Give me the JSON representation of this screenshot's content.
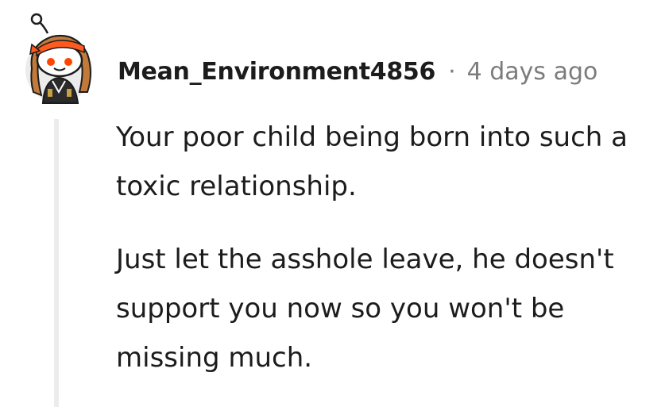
{
  "comment": {
    "author": "Mean_Environment4856",
    "separator": "·",
    "timestamp": "4 days ago",
    "paragraphs": [
      "Your poor child being born into such a toxic relationship.",
      "Just let the asshole leave, he doesn't support you now so you won't be missing much."
    ],
    "avatar": {
      "icon": "snoo-avatar-icon",
      "colors": {
        "headband": "#ff5a1f",
        "hair": "#c27a3a",
        "face": "#ffffff",
        "eyes": "#ff4500",
        "outfit": "#2b2b2b",
        "background": "#ececec"
      }
    }
  }
}
